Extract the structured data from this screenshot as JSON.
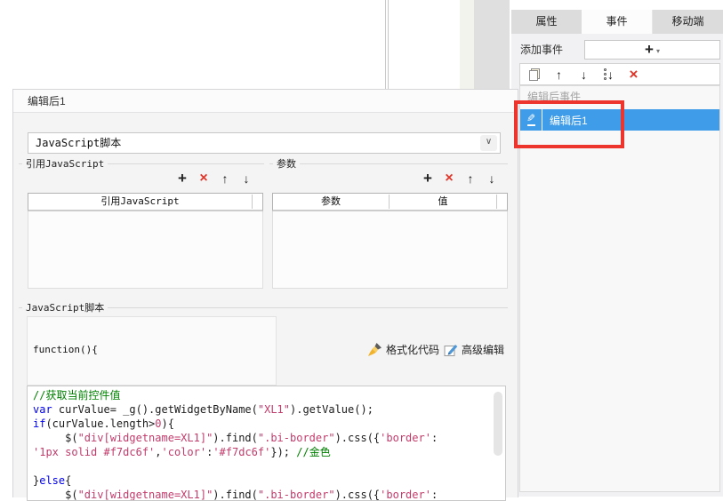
{
  "glyphs": {
    "plus": "+",
    "caret_down": "▾",
    "chevron_down": "∨",
    "arrow_up": "↑",
    "arrow_down": "↓",
    "delete_x": "×",
    "pencil": "✎"
  },
  "colors": {
    "selection_blue": "#3e9ce9",
    "annotation_red": "#ee352d",
    "code_comment": "#008000",
    "code_keyword": "#0000ee",
    "code_string": "#c23b6b",
    "code_number": "#c23b6b",
    "code_plain": "#1b1b1b"
  },
  "right_panel": {
    "tabs": [
      {
        "label": "属性",
        "selected": false
      },
      {
        "label": "事件",
        "selected": true
      },
      {
        "label": "移动端",
        "selected": false
      }
    ],
    "add_event_label": "添加事件",
    "event_group_label": "编辑后事件",
    "selected_event_label": "编辑后1"
  },
  "dialog": {
    "title": "编辑后1",
    "event_type_value": "JavaScript脚本",
    "ref_js_section": {
      "legend": "引用JavaScript",
      "table_header": "引用JavaScript"
    },
    "params_section": {
      "legend": "参数",
      "columns": [
        "参数",
        "值"
      ]
    },
    "js_section": {
      "legend": "JavaScript脚本",
      "function_signature": "function(){",
      "format_button": "格式化代码",
      "advanced_button": "高级编辑"
    }
  },
  "code_editor": {
    "lines": [
      [
        {
          "t": "//获取当前控件值",
          "c": "comment"
        }
      ],
      [
        {
          "t": "var",
          "c": "keyword"
        },
        {
          "t": " curValue= _g().getWidgetByName(",
          "c": "plain"
        },
        {
          "t": "\"XL1\"",
          "c": "string"
        },
        {
          "t": ").getValue();",
          "c": "plain"
        }
      ],
      [
        {
          "t": "if",
          "c": "keyword"
        },
        {
          "t": "(curValue.length>",
          "c": "plain"
        },
        {
          "t": "0",
          "c": "number"
        },
        {
          "t": "){",
          "c": "plain"
        }
      ],
      [
        {
          "t": "     $(",
          "c": "plain"
        },
        {
          "t": "\"div[widgetname=XL1]\"",
          "c": "string"
        },
        {
          "t": ").find(",
          "c": "plain"
        },
        {
          "t": "\".bi-border\"",
          "c": "string"
        },
        {
          "t": ").css({",
          "c": "plain"
        },
        {
          "t": "'border'",
          "c": "string"
        },
        {
          "t": ":",
          "c": "plain"
        }
      ],
      [
        {
          "t": "'1px solid #f7dc6f'",
          "c": "string"
        },
        {
          "t": ",",
          "c": "plain"
        },
        {
          "t": "'color'",
          "c": "string"
        },
        {
          "t": ":",
          "c": "plain"
        },
        {
          "t": "'#f7dc6f'",
          "c": "string"
        },
        {
          "t": "}); ",
          "c": "plain"
        },
        {
          "t": "//金色",
          "c": "comment"
        }
      ],
      [],
      [
        {
          "t": "}",
          "c": "plain"
        },
        {
          "t": "else",
          "c": "keyword"
        },
        {
          "t": "{",
          "c": "plain"
        }
      ],
      [
        {
          "t": "     $(",
          "c": "plain"
        },
        {
          "t": "\"div[widgetname=XL1]\"",
          "c": "string"
        },
        {
          "t": ").find(",
          "c": "plain"
        },
        {
          "t": "\".bi-border\"",
          "c": "string"
        },
        {
          "t": ").css({",
          "c": "plain"
        },
        {
          "t": "'border'",
          "c": "string"
        },
        {
          "t": ":",
          "c": "plain"
        }
      ]
    ]
  }
}
